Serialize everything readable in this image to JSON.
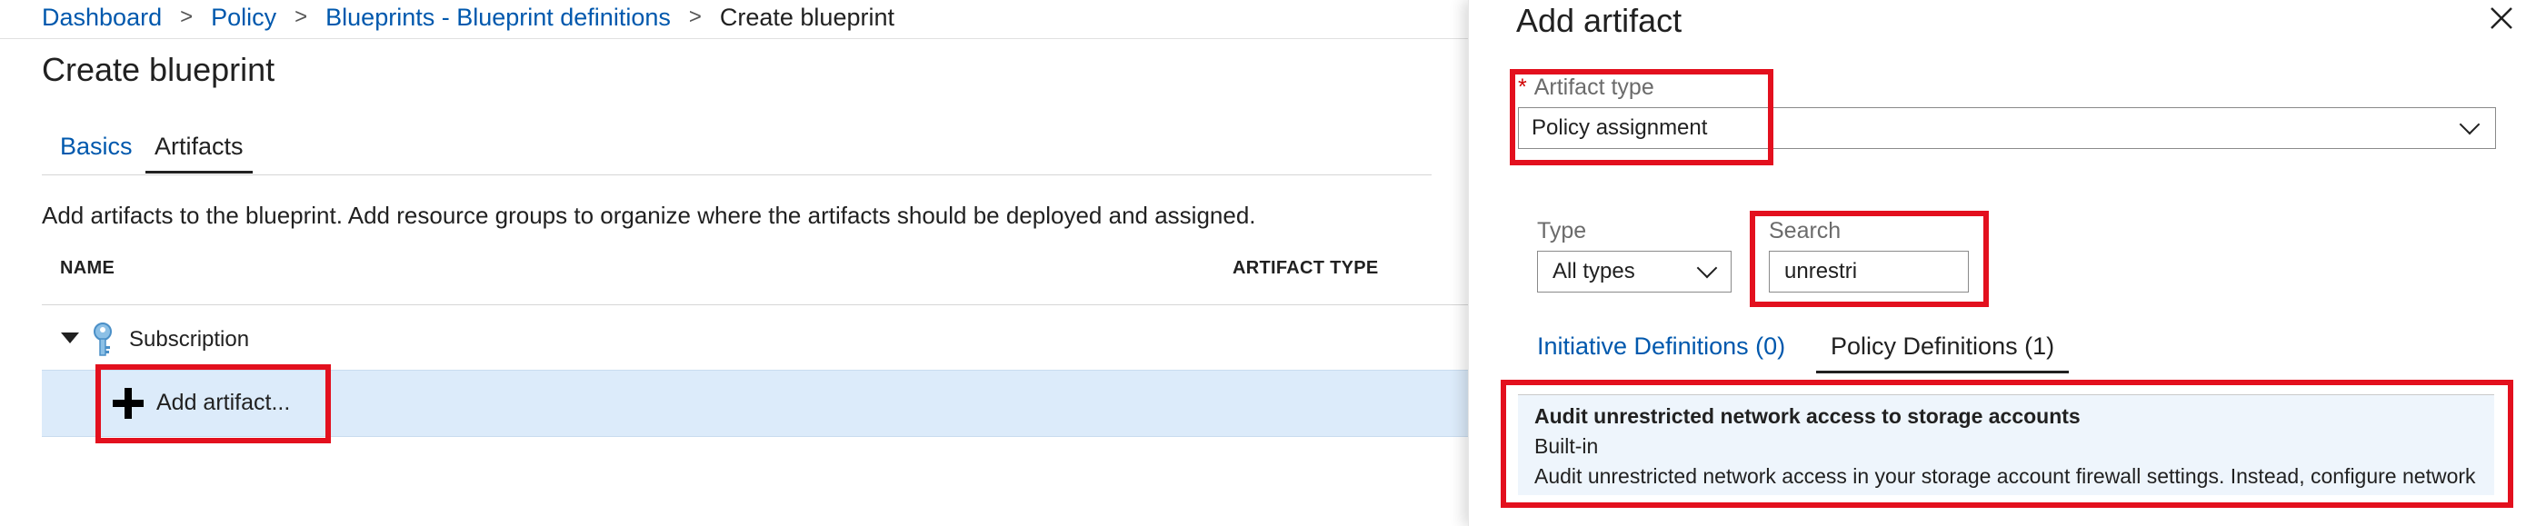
{
  "breadcrumb": {
    "items": [
      "Dashboard",
      "Policy",
      "Blueprints - Blueprint definitions",
      "Create blueprint"
    ],
    "separator": ">"
  },
  "page": {
    "title": "Create blueprint",
    "tabs": [
      "Basics",
      "Artifacts"
    ],
    "active_tab": "Artifacts",
    "description": "Add artifacts to the blueprint. Add resource groups to organize where the artifacts should be deployed and assigned.",
    "table": {
      "columns": [
        "NAME",
        "ARTIFACT TYPE"
      ],
      "subscription_label": "Subscription",
      "add_artifact_label": "Add artifact..."
    }
  },
  "blade": {
    "title": "Add artifact",
    "artifact_type": {
      "required_mark": "*",
      "label": "Artifact type",
      "value": "Policy assignment"
    },
    "type_filter": {
      "label": "Type",
      "value": "All types"
    },
    "search": {
      "label": "Search",
      "value": "unrestri"
    },
    "tabs": [
      "Initiative Definitions (0)",
      "Policy Definitions (1)"
    ],
    "active_tab": "Policy Definitions (1)",
    "result": {
      "title": "Audit unrestricted network access to storage accounts",
      "source": "Built-in",
      "description": "Audit unrestricted network access in your storage account firewall settings. Instead, configure network"
    }
  },
  "colors": {
    "link": "#0058ad",
    "highlight_box": "#e3101e",
    "selected_row": "#dcebfa",
    "result_bg": "#eef5fc",
    "required": "#d10000"
  },
  "icons": [
    "key-icon",
    "plus-icon",
    "chevron-down-icon",
    "close-icon",
    "caret-down-icon"
  ]
}
